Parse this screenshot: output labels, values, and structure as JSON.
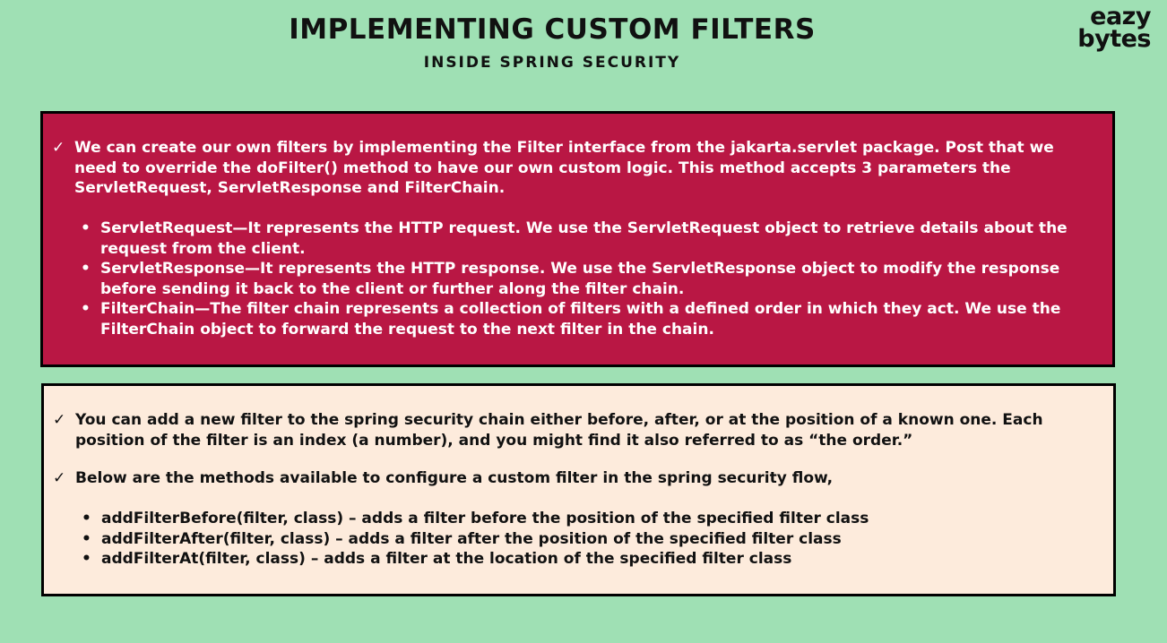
{
  "header": {
    "title": "IMPLEMENTING CUSTOM FILTERS",
    "subtitle": "INSIDE SPRING SECURITY"
  },
  "logo": {
    "line1": "eazy",
    "line2": "bytes"
  },
  "top_box": {
    "check_mark": "✓",
    "intro": "We can create our own filters by implementing the Filter interface from the jakarta.servlet package. Post that we need to override the doFilter() method to have our own custom logic. This method accepts 3 parameters the ServletRequest, ServletResponse and FilterChain.",
    "bullets": [
      "ServletRequest—It represents the HTTP request. We use the ServletRequest object to retrieve details about the request from the client.",
      "ServletResponse—It represents the HTTP response. We use the ServletResponse object to modify the response before sending it back to the client or further along the filter chain.",
      "FilterChain—The filter chain represents a collection of filters with a defined order in which they act. We use the FilterChain object to forward the request to the next filter in the chain."
    ]
  },
  "bottom_box": {
    "check_mark": "✓",
    "point1": "You can add a new filter to the spring security chain either before, after, or at the position of a known one. Each position of the filter is an index (a number), and you might find it also referred to as “the order.”",
    "point2": "Below are the methods available to configure a custom filter in the spring security flow,",
    "methods": [
      "addFilterBefore(filter, class) – adds a filter before the position of the specified filter class",
      "addFilterAfter(filter, class) – adds a filter after the position of the specified filter class",
      "addFilterAt(filter, class) – adds a filter at the location of the specified filter class"
    ]
  },
  "colors": {
    "background": "#9fe0b4",
    "top_box": "#b91744",
    "bottom_box": "#fdebdc"
  }
}
